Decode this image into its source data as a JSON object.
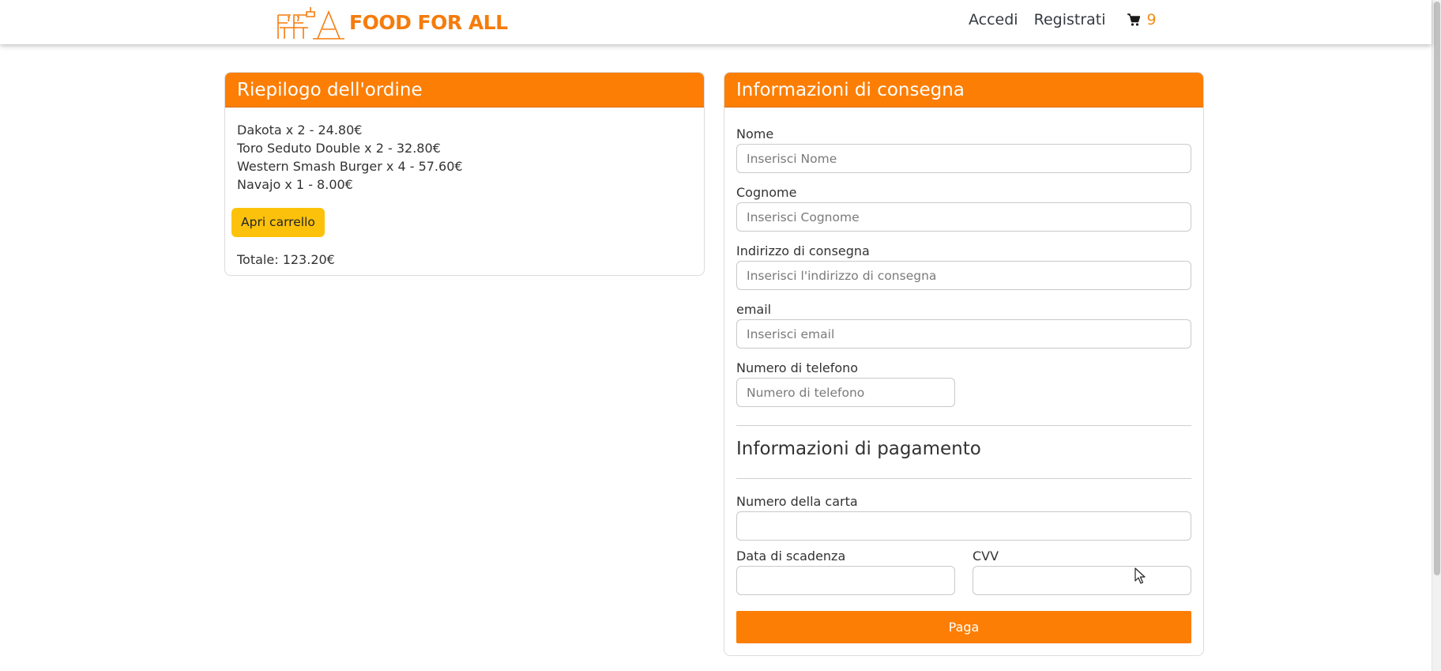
{
  "nav": {
    "brand": "FOOD FOR ALL",
    "login": "Accedi",
    "register": "Registrati",
    "cart_count": "9",
    "brand_color": "#f57c0c"
  },
  "summary": {
    "title": "Riepilogo dell'ordine",
    "items": [
      "Dakota x 2 - 24.80€",
      "Toro Seduto Double x 2 - 32.80€",
      "Western Smash Burger x 4 - 57.60€",
      "Navajo x 1 - 8.00€"
    ],
    "open_cart": "Apri carrello",
    "total": "Totale: 123.20€"
  },
  "delivery": {
    "title": "Informazioni di consegna",
    "name_label": "Nome",
    "name_placeholder": "Inserisci Nome",
    "surname_label": "Cognome",
    "surname_placeholder": "Inserisci Cognome",
    "address_label": "Indirizzo di consegna",
    "address_placeholder": "Inserisci l'indirizzo di consegna",
    "email_label": "email",
    "email_placeholder": "Inserisci email",
    "phone_label": "Numero di telefono",
    "phone_placeholder": "Numero di telefono"
  },
  "payment": {
    "title": "Informazioni di pagamento",
    "card_label": "Numero della carta",
    "card_value": "",
    "expiry_label": "Data di scadenza",
    "expiry_value": "",
    "cvv_label": "CVV",
    "cvv_value": "",
    "pay_button": "Paga"
  },
  "colors": {
    "accent": "#fc7e04",
    "button_yellow": "#fcc10a"
  },
  "icons": {
    "logo": "food-for-all-logo",
    "cart": "shopping-cart-icon"
  }
}
